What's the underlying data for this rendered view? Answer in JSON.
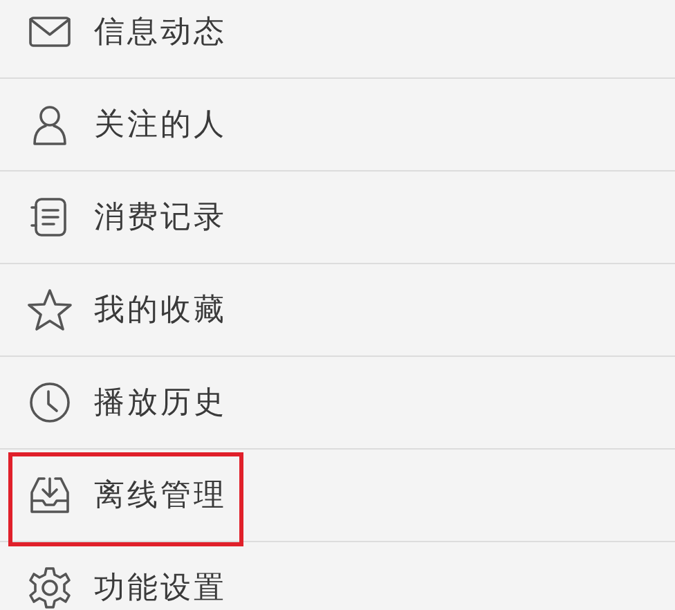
{
  "menu": {
    "items": [
      {
        "label": "信息动态",
        "highlighted": false
      },
      {
        "label": "关注的人",
        "highlighted": false
      },
      {
        "label": "消费记录",
        "highlighted": false
      },
      {
        "label": "我的收藏",
        "highlighted": false
      },
      {
        "label": "播放历史",
        "highlighted": false
      },
      {
        "label": "离线管理",
        "highlighted": true
      },
      {
        "label": "功能设置",
        "highlighted": false
      }
    ]
  }
}
